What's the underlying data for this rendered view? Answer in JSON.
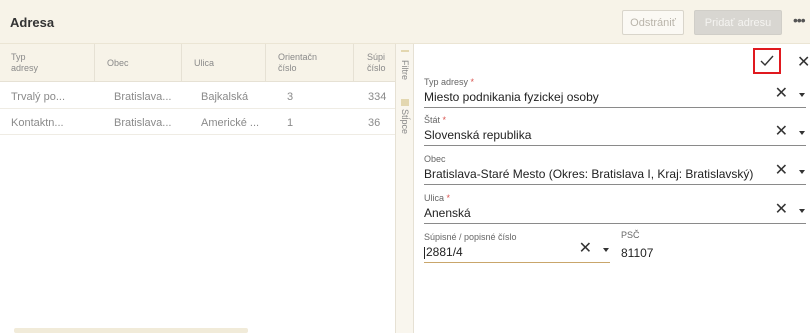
{
  "header": {
    "title": "Adresa",
    "remove_label": "Odstrániť",
    "add_label": "Pridať adresu",
    "more_icon": "more-horizontal-icon"
  },
  "grid": {
    "columns": [
      "Typ adresy",
      "Obec",
      "Ulica",
      "Orientačn číslo",
      "Súpi číslo"
    ],
    "column_lines": [
      [
        "Typ",
        "adresy"
      ],
      [
        "Obec"
      ],
      [
        "Ulica"
      ],
      [
        "Orientačn",
        "číslo"
      ],
      [
        "Súpi",
        "číslo"
      ]
    ],
    "rows": [
      [
        "Trvalý po...",
        "Bratislava...",
        "Bajkalská",
        "3",
        "334"
      ],
      [
        "Kontaktn...",
        "Bratislava...",
        "Americké ...",
        "1",
        "36"
      ]
    ]
  },
  "sidebar": {
    "filter_label": "Filtre",
    "columns_label": "Stĺpce"
  },
  "panel": {
    "confirm_icon": "checkmark-icon",
    "close_icon": "close-icon",
    "fields": [
      {
        "label": "Typ adresy",
        "required": "*",
        "value": "Miesto podnikania fyzickej osoby"
      },
      {
        "label": "Štát",
        "required": "*",
        "value": "Slovenská republika"
      },
      {
        "label": "Obec",
        "required": "",
        "value": "Bratislava-Staré Mesto (Okres: Bratislava I, Kraj: Bratislavský)"
      },
      {
        "label": "Ulica",
        "required": "*",
        "value": "Anenská"
      }
    ],
    "supisne": {
      "label": "Súpisné / popisné číslo",
      "value": "2881/4"
    },
    "psc": {
      "label": "PSČ",
      "value": "81107"
    }
  },
  "colors": {
    "header_bg": "#f7f3e8",
    "confirm_highlight": "#e0191f",
    "required": "#d9534f"
  }
}
